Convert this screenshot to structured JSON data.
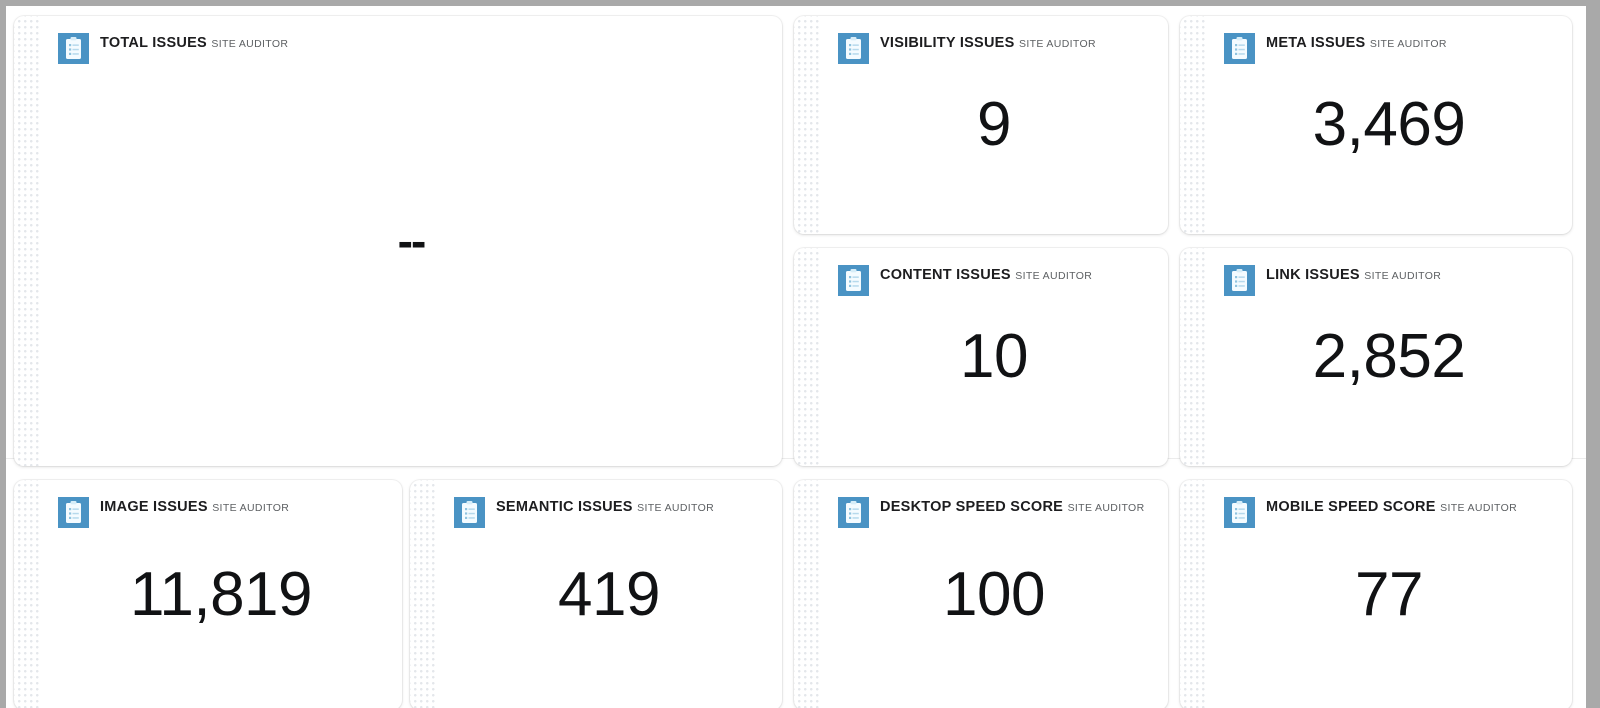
{
  "page": {
    "background_color": "#a9a9a9",
    "canvas_color": "#ffffff",
    "accent_color": "#4a93c4"
  },
  "widgets": [
    {
      "id": "total-issues",
      "title": "TOTAL ISSUES",
      "subtitle": "SITE AUDITOR",
      "value": "--",
      "icon": "clipboard-icon"
    },
    {
      "id": "visibility-issues",
      "title": "VISIBILITY ISSUES",
      "subtitle": "SITE AUDITOR",
      "value": "9",
      "icon": "clipboard-icon"
    },
    {
      "id": "meta-issues",
      "title": "META ISSUES",
      "subtitle": "SITE AUDITOR",
      "value": "3,469",
      "icon": "clipboard-icon"
    },
    {
      "id": "content-issues",
      "title": "CONTENT ISSUES",
      "subtitle": "SITE AUDITOR",
      "value": "10",
      "icon": "clipboard-icon"
    },
    {
      "id": "link-issues",
      "title": "LINK ISSUES",
      "subtitle": "SITE AUDITOR",
      "value": "2,852",
      "icon": "clipboard-icon"
    },
    {
      "id": "image-issues",
      "title": "IMAGE ISSUES",
      "subtitle": "SITE AUDITOR",
      "value": "11,819",
      "icon": "clipboard-icon"
    },
    {
      "id": "semantic-issues",
      "title": "SEMANTIC ISSUES",
      "subtitle": "SITE AUDITOR",
      "value": "419",
      "icon": "clipboard-icon"
    },
    {
      "id": "desktop-speed-score",
      "title": "DESKTOP SPEED SCORE",
      "subtitle": "SITE AUDITOR",
      "value": "100",
      "icon": "clipboard-icon"
    },
    {
      "id": "mobile-speed-score",
      "title": "MOBILE SPEED SCORE",
      "subtitle": "SITE AUDITOR",
      "value": "77",
      "icon": "clipboard-icon"
    }
  ]
}
